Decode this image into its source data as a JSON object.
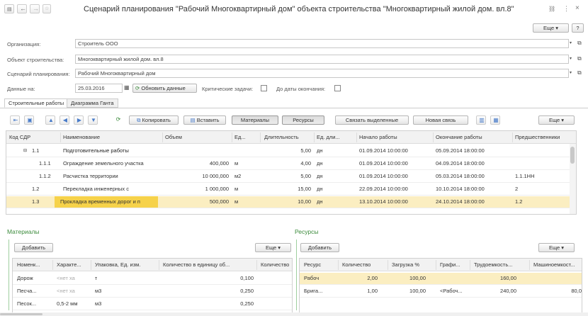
{
  "window": {
    "title": "Сценарий планирования \"Рабочий Многоквартирный дом\" объекта строительства \"Многоквартирный жилой дом. вл.8\"",
    "more_label": "Еще",
    "help_label": "?"
  },
  "form": {
    "org_label": "Организация:",
    "org_value": "Строитель ООО",
    "object_label": "Объект строительства:",
    "object_value": "Многоквартирный жилой дом. вл.8",
    "scenario_label": "Сценарий планирования:",
    "scenario_value": "Рабочий Многоквартирный дом",
    "date_label": "Данные на:",
    "date_value": "25.03.2016",
    "refresh_label": "Обновить данные",
    "critical_label": "Критические задачи:",
    "deadline_label": "До даты окончания:"
  },
  "tabs": [
    "Строительные работы",
    "Диаграмма Ганта"
  ],
  "toolbar": {
    "copy_label": "Копировать",
    "paste_label": "Вставить",
    "materials_label": "Материалы",
    "resources_label": "Ресурсы",
    "link_selected_label": "Связать выделенные",
    "new_link_label": "Новая связь",
    "more_label": "Еще"
  },
  "works_table": {
    "columns": [
      "Код СДР",
      "Наименование",
      "Объем",
      "Ед...",
      "Длительность",
      "Ед. дли...",
      "Начало работы",
      "Окончание работы",
      "Предшественники"
    ],
    "rows": [
      {
        "code": "1.1",
        "name": "Подготовительные работы",
        "volume": "",
        "unit": "",
        "duration": "5,00",
        "dunit": "дн",
        "start": "01.09.2014 10:00:00",
        "end": "05.09.2014 18:00:00",
        "pred": "",
        "group": true
      },
      {
        "code": "1.1.1",
        "name": "Ограждение земельного участка",
        "volume": "400,000",
        "unit": "м",
        "duration": "4,00",
        "dunit": "дн",
        "start": "01.09.2014 10:00:00",
        "end": "04.09.2014 18:00:00",
        "pred": ""
      },
      {
        "code": "1.1.2",
        "name": "Расчистка территории",
        "volume": "10 000,000",
        "unit": "м2",
        "duration": "5,00",
        "dunit": "дн",
        "start": "01.09.2014 10:00:00",
        "end": "05.03.2014 18:00:00",
        "pred": "1.1.1НН"
      },
      {
        "code": "1.2",
        "name": "Перекладка инженерных с",
        "volume": "1 000,000",
        "unit": "м",
        "duration": "15,00",
        "dunit": "дн",
        "start": "22.09.2014 10:00:00",
        "end": "10.10.2014 18:00:00",
        "pred": "2"
      },
      {
        "code": "1.3",
        "name": "Прокладка временных дорог и п",
        "volume": "500,000",
        "unit": "м",
        "duration": "10,00",
        "dunit": "дн",
        "start": "13.10.2014 10:00:00",
        "end": "24.10.2014 18:00:00",
        "pred": "1.2",
        "selected": true
      }
    ]
  },
  "materials": {
    "title": "Материалы",
    "add_label": "Добавить",
    "more_label": "Еще",
    "columns": [
      "Номенк...",
      "Характе...",
      "Упаковка, Ед. изм.",
      "Количество в единицу об...",
      "Количество"
    ],
    "rows": [
      {
        "name": "Дорож",
        "char": "<нет ха",
        "pack": "т",
        "qty": "0,100"
      },
      {
        "name": "Песча...",
        "char": "<нет ха",
        "pack": "м3",
        "qty": "0,250"
      },
      {
        "name": "Песок...",
        "char": "0,5-2 мм",
        "pack": "м3",
        "qty": "0,250"
      }
    ]
  },
  "resources": {
    "title": "Ресурсы",
    "add_label": "Добавить",
    "more_label": "Еще",
    "columns": [
      "Ресурс",
      "Количество",
      "Загрузка %",
      "Графи...",
      "Трудоемкость...",
      "Машиноемкост..."
    ],
    "rows": [
      {
        "name": "Рабоч",
        "qty": "2,00",
        "load": "100,00",
        "sched": "",
        "labor": "160,00",
        "machine": "",
        "selected": true
      },
      {
        "name": "Брига...",
        "qty": "1,00",
        "load": "100,00",
        "sched": "<Рабоч...",
        "labor": "240,00",
        "machine": "80,0"
      }
    ]
  }
}
